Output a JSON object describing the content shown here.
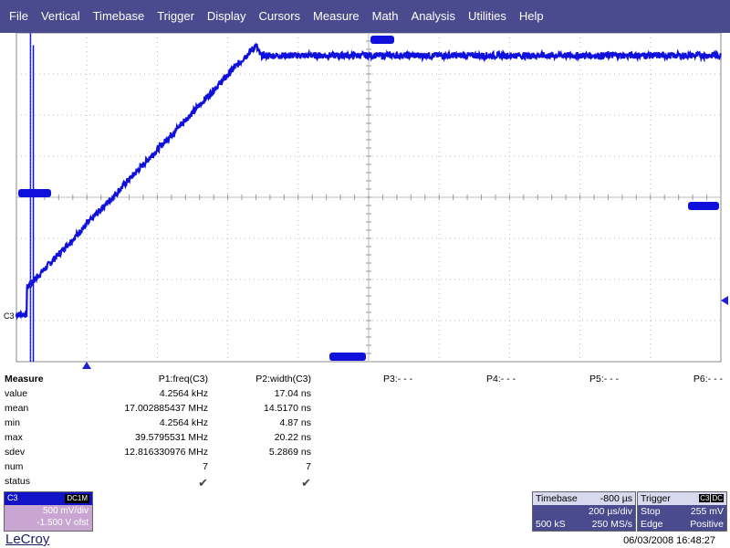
{
  "menu": [
    "File",
    "Vertical",
    "Timebase",
    "Trigger",
    "Display",
    "Cursors",
    "Measure",
    "Math",
    "Analysis",
    "Utilities",
    "Help"
  ],
  "scope": {
    "channel_label": "C3",
    "trace_color": "#1010dd",
    "grid_color": "#bcbcbc",
    "waveform": {
      "pre_edge_level_div": -2.85,
      "ramp_start_div": -2.2,
      "ramp_start_time_div": 0.15,
      "ramp_end_time_div": 3.4,
      "plateau_level_div": 3.45
    }
  },
  "measure": {
    "title": "Measure",
    "headers": [
      "P1:freq(C3)",
      "P2:width(C3)",
      "P3:- - -",
      "P4:- - -",
      "P5:- - -",
      "P6:- - -"
    ],
    "rows": [
      {
        "label": "value",
        "p1": "4.2564 kHz",
        "p2": "17.04 ns"
      },
      {
        "label": "mean",
        "p1": "17.002885437 MHz",
        "p2": "14.5170 ns"
      },
      {
        "label": "min",
        "p1": "4.2564 kHz",
        "p2": "4.87 ns"
      },
      {
        "label": "max",
        "p1": "39.5795531 MHz",
        "p2": "20.22 ns"
      },
      {
        "label": "sdev",
        "p1": "12.816330976 MHz",
        "p2": "5.2869 ns"
      },
      {
        "label": "num",
        "p1": "7",
        "p2": "7"
      },
      {
        "label": "status",
        "p1": "✔",
        "p2": "✔"
      }
    ]
  },
  "channel": {
    "name": "C3",
    "coupling": "DC1M",
    "vdiv": "500 mV/div",
    "offset": "-1.500 V ofst"
  },
  "timebase": {
    "title": "Timebase",
    "delay": "-800 µs",
    "tdiv": "200 µs/div",
    "samples": "500 kS",
    "rate": "250 MS/s"
  },
  "trigger": {
    "title": "Trigger",
    "ch": "C3",
    "coupling": "DC",
    "mode": "Stop",
    "level": "255 mV",
    "type": "Edge",
    "slope": "Positive"
  },
  "brand": "LeCroy",
  "datetime": "06/03/2008 16:48:27"
}
